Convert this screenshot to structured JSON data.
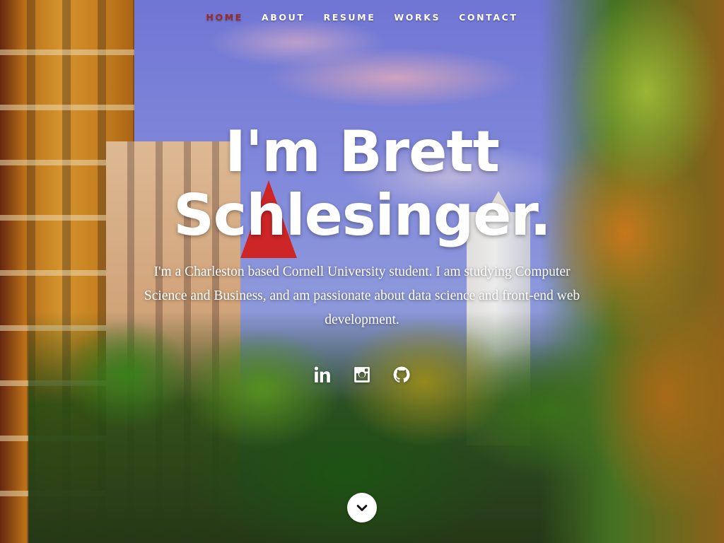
{
  "nav": {
    "items": [
      {
        "label": "Home",
        "active": true
      },
      {
        "label": "About",
        "active": false
      },
      {
        "label": "Resume",
        "active": false
      },
      {
        "label": "Works",
        "active": false
      },
      {
        "label": "Contact",
        "active": false
      }
    ]
  },
  "banner": {
    "headline_line1": "I'm Brett",
    "headline_line2": "Schlesinger.",
    "intro": "I'm a Charleston based Cornell University student. I am studying Computer Science and Business, and am passionate about data science and front-end web development."
  },
  "social": [
    {
      "icon": "linkedin-icon"
    },
    {
      "icon": "instagram-icon"
    },
    {
      "icon": "github-icon"
    }
  ],
  "scroll_down": {
    "icon": "chevron-down-icon"
  },
  "colors": {
    "active_nav": "#9b2a2a",
    "text": "#ffffff"
  }
}
